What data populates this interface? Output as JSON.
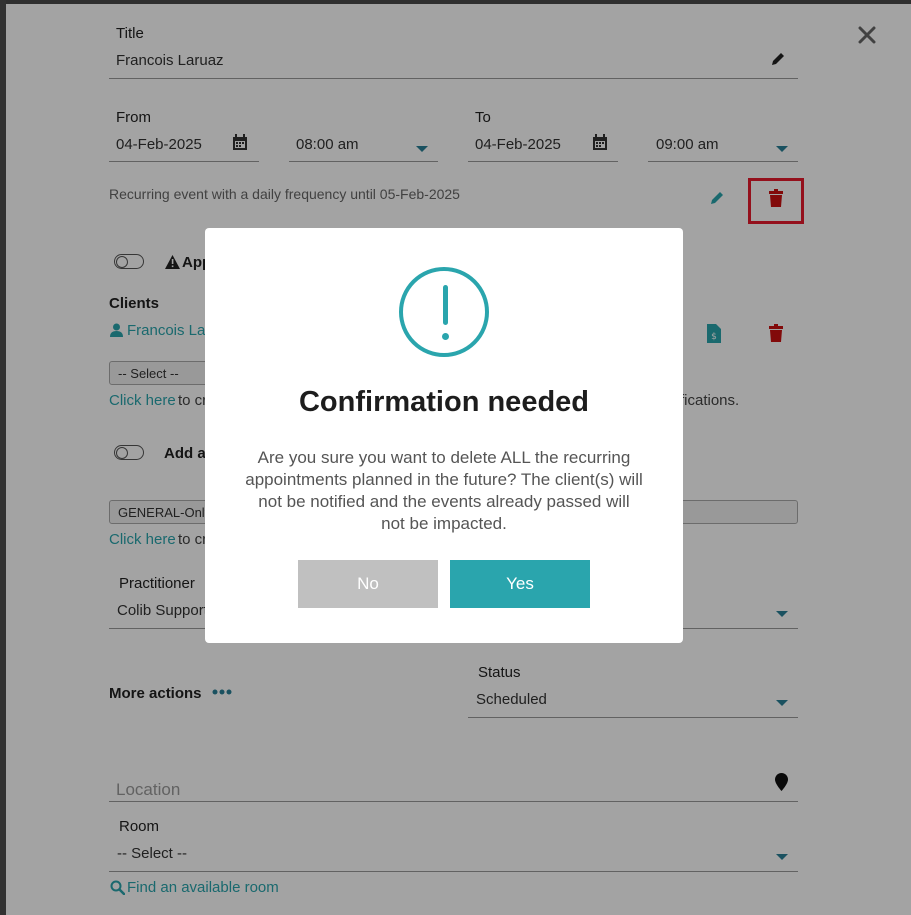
{
  "form": {
    "title_label": "Title",
    "title_value": "Francois Laruaz",
    "from_label": "From",
    "from_date": "04-Feb-2025",
    "from_time": "08:00 am",
    "to_label": "To",
    "to_date": "04-Feb-2025",
    "to_time": "09:00 am",
    "recurring_text": "Recurring event with a daily frequency until 05-Feb-2025",
    "app_toggle_label_partial": "App",
    "clients_label": "Clients",
    "client_name_partial": "Francois Lar",
    "client_select_placeholder": "-- Select --",
    "click_here_1": "Click here",
    "click_here_1_suffix": "to cr",
    "notifications_partial": "fications.",
    "add_toggle_label_partial": "Add a",
    "service_select_partial": "GENERAL-Only",
    "click_here_2": "Click here",
    "click_here_2_suffix": "to cr",
    "practitioner_label": "Practitioner",
    "practitioner_value_partial": "Colib Support",
    "more_actions_label": "More actions",
    "status_label": "Status",
    "status_value": "Scheduled",
    "location_placeholder": "Location",
    "room_label": "Room",
    "room_value": "-- Select --",
    "find_room_link": "Find an available room"
  },
  "modal": {
    "title": "Confirmation needed",
    "message": "Are you sure you want to delete ALL the recurring appointments planned in the future? The client(s) will not be notified and the events already passed will not be impacted.",
    "no_label": "No",
    "yes_label": "Yes"
  },
  "icons": {
    "close": "close-icon",
    "edit": "pencil-icon",
    "calendar": "calendar-icon",
    "trash": "trash-icon",
    "user": "user-icon",
    "invoice": "invoice-icon",
    "location": "map-pin-icon",
    "search": "search-icon",
    "warning": "warning-icon",
    "more": "more-dots-icon",
    "confirm": "exclamation-circle-icon"
  },
  "colors": {
    "accent": "#2aa5ad",
    "danger": "#cc1111",
    "highlight": "#e8192c",
    "no_button": "#c0c0c0"
  }
}
